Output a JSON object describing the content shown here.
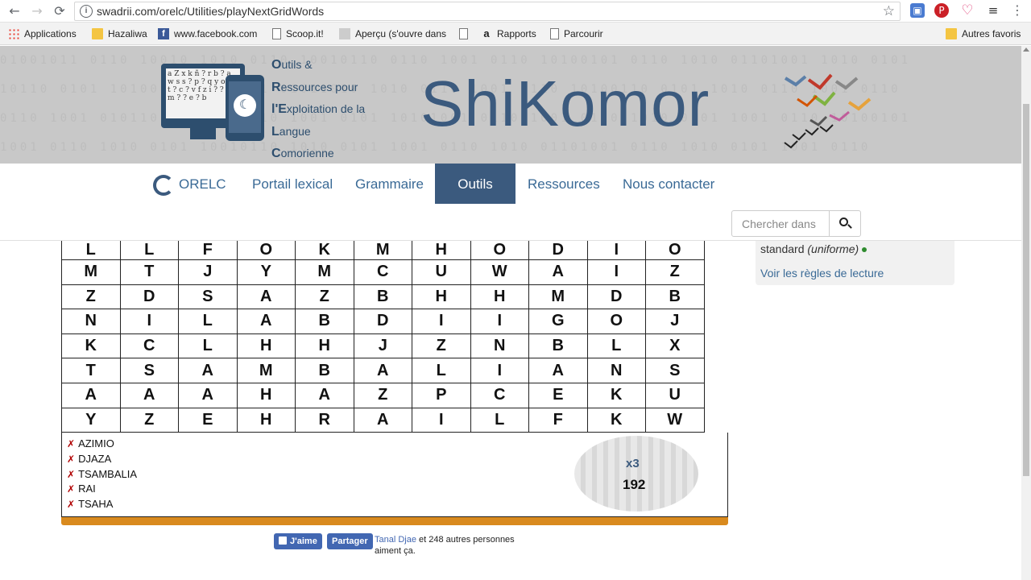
{
  "browser": {
    "url": "swadrii.com/orelc/Utilities/playNextGridWords",
    "bookmarks": [
      "Applications",
      "Hazaliwa",
      "www.facebook.com",
      "Scoop.it!",
      "Aperçu (s'ouvre dans",
      "Rapports",
      "Parcourir"
    ],
    "other_bookmarks": "Autres favoris"
  },
  "header": {
    "tagline": [
      {
        "initial": "O",
        "rest": "utils &"
      },
      {
        "initial": "R",
        "rest": "essources pour"
      },
      {
        "initial": "l'E",
        "rest": "xploitation de la"
      },
      {
        "initial": "L",
        "rest": "angue"
      },
      {
        "initial": "C",
        "rest": "omorienne"
      }
    ],
    "brand": "ShiKomor"
  },
  "nav": {
    "items": [
      "ORELC",
      "Portail lexical",
      "Grammaire",
      "Outils",
      "Ressources",
      "Nous contacter"
    ],
    "active": "Outils",
    "search_placeholder": "Chercher dans"
  },
  "grid": {
    "rows": [
      [
        "L",
        "L",
        "F",
        "O",
        "K",
        "M",
        "H",
        "O",
        "D",
        "I",
        "O"
      ],
      [
        "M",
        "T",
        "J",
        "Y",
        "M",
        "C",
        "U",
        "W",
        "A",
        "I",
        "Z"
      ],
      [
        "Z",
        "D",
        "S",
        "A",
        "Z",
        "B",
        "H",
        "H",
        "M",
        "D",
        "B"
      ],
      [
        "N",
        "I",
        "L",
        "A",
        "B",
        "D",
        "I",
        "I",
        "G",
        "O",
        "J"
      ],
      [
        "K",
        "C",
        "L",
        "H",
        "H",
        "J",
        "Z",
        "N",
        "B",
        "L",
        "X"
      ],
      [
        "T",
        "S",
        "A",
        "M",
        "B",
        "A",
        "L",
        "I",
        "A",
        "N",
        "S"
      ],
      [
        "A",
        "A",
        "A",
        "H",
        "A",
        "Z",
        "P",
        "C",
        "E",
        "K",
        "U"
      ],
      [
        "Y",
        "Z",
        "E",
        "H",
        "R",
        "A",
        "I",
        "L",
        "F",
        "K",
        "W"
      ]
    ]
  },
  "words": {
    "items": [
      "AZIMIO",
      "DJAZA",
      "TSAMBALIA",
      "RAI",
      "TSAHA"
    ],
    "marker": "✗",
    "multiplier": "x3",
    "score": "192"
  },
  "sidebar": {
    "mode_prefix": "standard",
    "mode_italic": "(uniforme)",
    "rules_link": "Voir les règles de lecture"
  },
  "social": {
    "like_label": "J'aime",
    "share_label": "Partager",
    "name": "Tanal Djae",
    "rest": " et 248 autres personnes aiment ça."
  },
  "colors": {
    "brand": "#3b5a7e",
    "progress": "#d98a1e",
    "link": "#3a6a96"
  }
}
